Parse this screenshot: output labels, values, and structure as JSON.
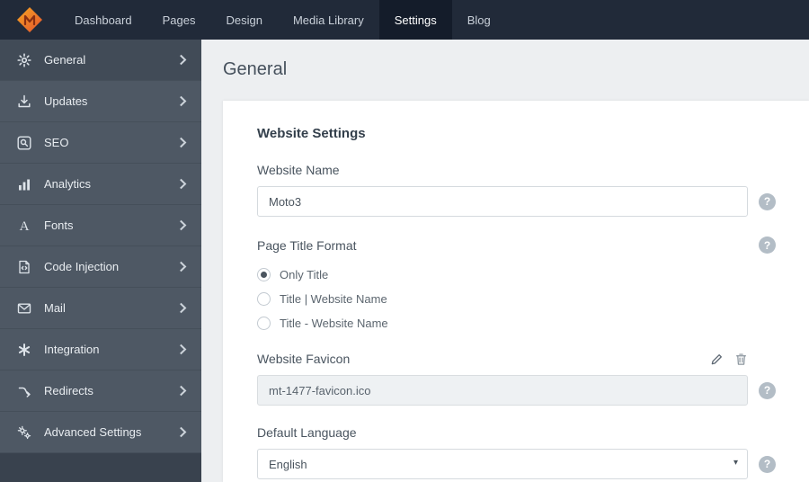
{
  "topbar": {
    "items": [
      {
        "label": "Dashboard",
        "active": false
      },
      {
        "label": "Pages",
        "active": false
      },
      {
        "label": "Design",
        "active": false
      },
      {
        "label": "Media Library",
        "active": false
      },
      {
        "label": "Settings",
        "active": true
      },
      {
        "label": "Blog",
        "active": false
      }
    ]
  },
  "sidebar": {
    "items": [
      {
        "label": "General",
        "icon": "gear-icon",
        "active": true
      },
      {
        "label": "Updates",
        "icon": "download-icon",
        "active": false
      },
      {
        "label": "SEO",
        "icon": "search-icon",
        "active": false
      },
      {
        "label": "Analytics",
        "icon": "bar-chart-icon",
        "active": false
      },
      {
        "label": "Fonts",
        "icon": "font-icon",
        "active": false
      },
      {
        "label": "Code Injection",
        "icon": "code-file-icon",
        "active": false
      },
      {
        "label": "Mail",
        "icon": "envelope-icon",
        "active": false
      },
      {
        "label": "Integration",
        "icon": "asterisk-icon",
        "active": false
      },
      {
        "label": "Redirects",
        "icon": "redirect-icon",
        "active": false
      },
      {
        "label": "Advanced Settings",
        "icon": "gears-icon",
        "active": false
      }
    ]
  },
  "page": {
    "title": "General",
    "section_title": "Website Settings",
    "website_name": {
      "label": "Website Name",
      "value": "Moto3"
    },
    "page_title_format": {
      "label": "Page Title Format",
      "options": [
        {
          "label": "Only Title",
          "selected": true
        },
        {
          "label": "Title | Website Name",
          "selected": false
        },
        {
          "label": "Title - Website Name",
          "selected": false
        }
      ]
    },
    "website_favicon": {
      "label": "Website Favicon",
      "value": "mt-1477-favicon.ico"
    },
    "default_language": {
      "label": "Default Language",
      "value": "English"
    }
  },
  "colors": {
    "topbar_bg": "#212a39",
    "topbar_active_bg": "#141c2a",
    "sidebar_bg": "#4e5864",
    "sidebar_active_bg": "#414b57",
    "logo_orange": "#f39b2d",
    "logo_red": "#e5532e",
    "page_bg": "#edeff1",
    "card_bg": "#ffffff"
  }
}
